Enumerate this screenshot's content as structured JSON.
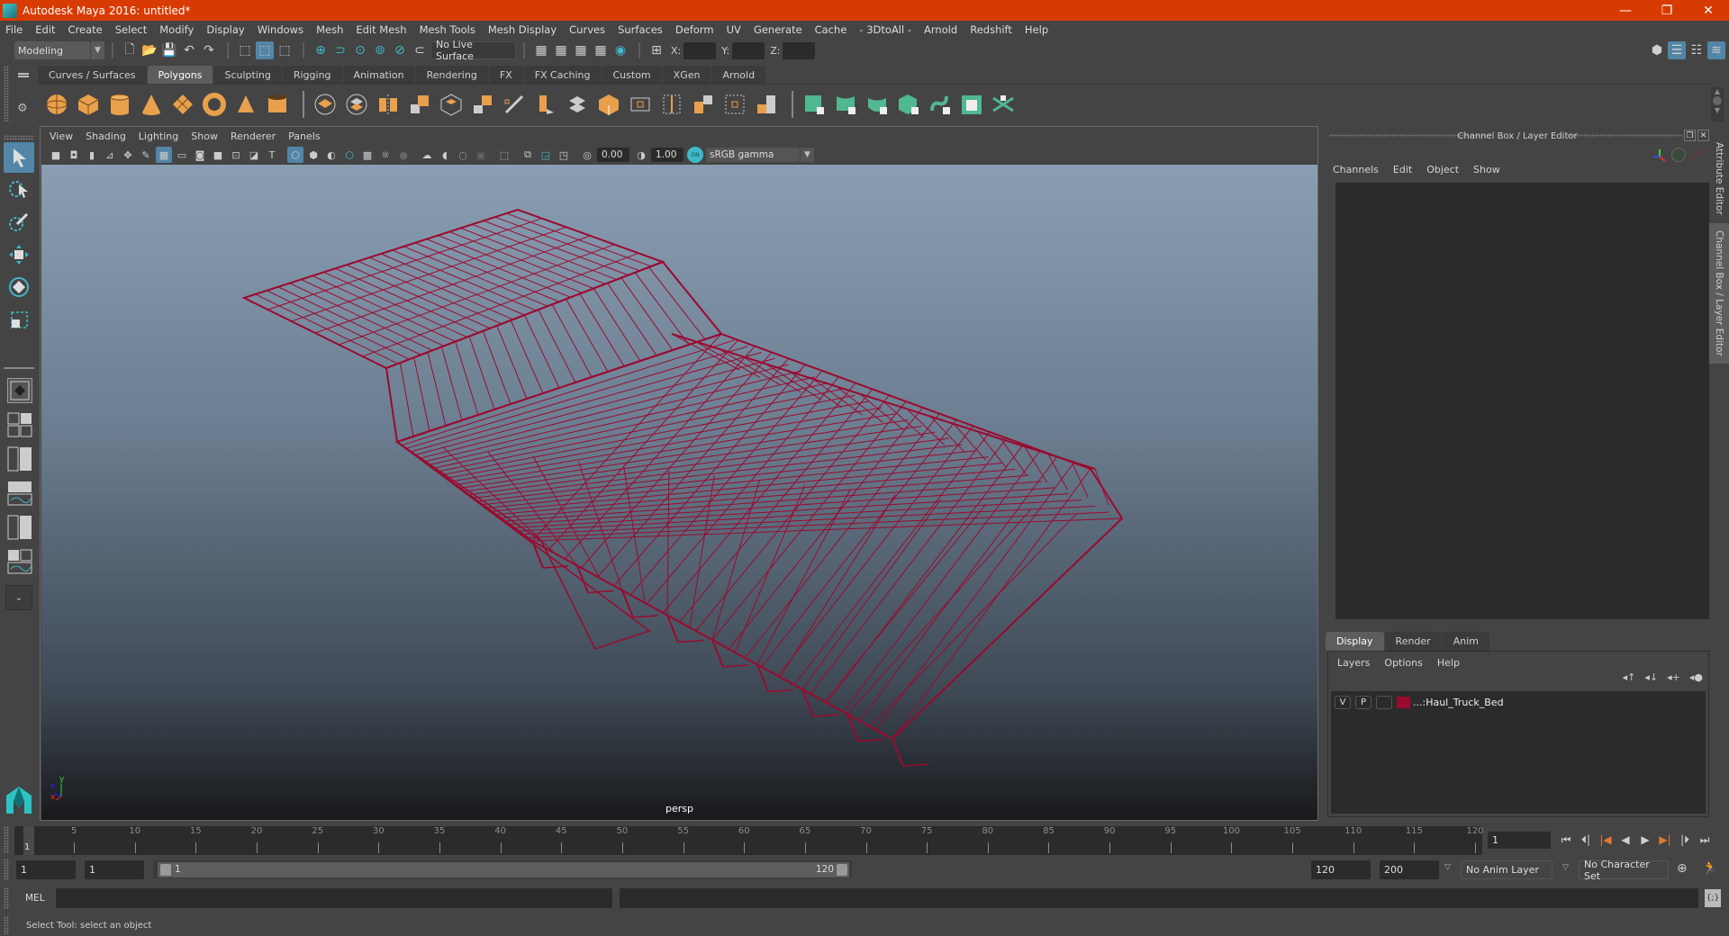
{
  "window": {
    "title": "Autodesk Maya 2016: untitled*",
    "controls": {
      "minimize": "—",
      "restore": "❐",
      "close": "✕"
    }
  },
  "menubar": [
    "File",
    "Edit",
    "Create",
    "Select",
    "Modify",
    "Display",
    "Windows",
    "Mesh",
    "Edit Mesh",
    "Mesh Tools",
    "Mesh Display",
    "Curves",
    "Surfaces",
    "Deform",
    "UV",
    "Generate",
    "Cache",
    "- 3DtoAll -",
    "Arnold",
    "Redshift",
    "Help"
  ],
  "statusline": {
    "menuset": "Modeling",
    "live_surface": "No Live Surface",
    "x_label": "X:",
    "y_label": "Y:",
    "z_label": "Z:",
    "x_value": "",
    "y_value": "",
    "z_value": ""
  },
  "shelf": {
    "tabs": [
      {
        "label": "Curves / Surfaces",
        "active": false
      },
      {
        "label": "Polygons",
        "active": true
      },
      {
        "label": "Sculpting",
        "active": false
      },
      {
        "label": "Rigging",
        "active": false
      },
      {
        "label": "Animation",
        "active": false
      },
      {
        "label": "Rendering",
        "active": false
      },
      {
        "label": "FX",
        "active": false
      },
      {
        "label": "FX Caching",
        "active": false
      },
      {
        "label": "Custom",
        "active": false
      },
      {
        "label": "XGen",
        "active": false
      },
      {
        "label": "Arnold",
        "active": false
      }
    ],
    "icons": [
      "poly-sphere",
      "poly-cube",
      "poly-cylinder",
      "poly-cone",
      "poly-plane",
      "poly-torus",
      "poly-pyramid",
      "poly-pipe",
      "separator",
      "combine",
      "separate",
      "mirror",
      "smooth",
      "extrude",
      "bridge",
      "bevel",
      "multi-cut",
      "target-weld",
      "merge",
      "center-pivot",
      "edge-loop",
      "insert-edge",
      "connect",
      "boolean",
      "bevel-corner",
      "separator",
      "planar-uv",
      "cylindrical-uv",
      "spherical-uv",
      "automatic-uv",
      "unfold-uv",
      "uv-editor",
      "layout-uv"
    ],
    "colors": {
      "poly": "#e8a04c",
      "uv": "#4fb88e"
    }
  },
  "viewport": {
    "menu": [
      "View",
      "Shading",
      "Lighting",
      "Show",
      "Renderer",
      "Panels"
    ],
    "exposure": "0.00",
    "gamma": "1.00",
    "color_mgmt": "ON",
    "view_transform": "sRGB gamma",
    "camera": "persp",
    "axis": {
      "x": "x",
      "y": "y",
      "z": "z"
    },
    "wire_color": "#9b0a2f"
  },
  "channel_box": {
    "title": "Channel Box / Layer Editor",
    "menu": [
      "Channels",
      "Edit",
      "Object",
      "Show"
    ]
  },
  "layer_editor": {
    "tabs": [
      {
        "label": "Display",
        "active": true
      },
      {
        "label": "Render",
        "active": false
      },
      {
        "label": "Anim",
        "active": false
      }
    ],
    "menu": [
      "Layers",
      "Options",
      "Help"
    ],
    "layers": [
      {
        "visible": "V",
        "playback": "P",
        "type": "",
        "color": "#9b0a2f",
        "name": "...:Haul_Truck_Bed"
      }
    ]
  },
  "side_tabs": [
    {
      "label": "Attribute Editor",
      "active": false
    },
    {
      "label": "Channel Box / Layer Editor",
      "active": true
    }
  ],
  "timeline": {
    "start": 1,
    "end": 120,
    "ticks": [
      5,
      10,
      15,
      20,
      25,
      30,
      35,
      40,
      45,
      50,
      55,
      60,
      65,
      70,
      75,
      80,
      85,
      90,
      95,
      100,
      105,
      110,
      115,
      120
    ],
    "current_frame": "1",
    "current_frame_field": "1"
  },
  "range": {
    "start_field": "1",
    "playback_start": "1",
    "range_start_label": "1",
    "range_end_label": "120",
    "playback_end": "120",
    "end_field": "200",
    "anim_layer": "No Anim Layer",
    "character_set": "No Character Set"
  },
  "command_line": {
    "language": "MEL",
    "input": "",
    "result": ""
  },
  "help_line": "Select Tool: select an object"
}
